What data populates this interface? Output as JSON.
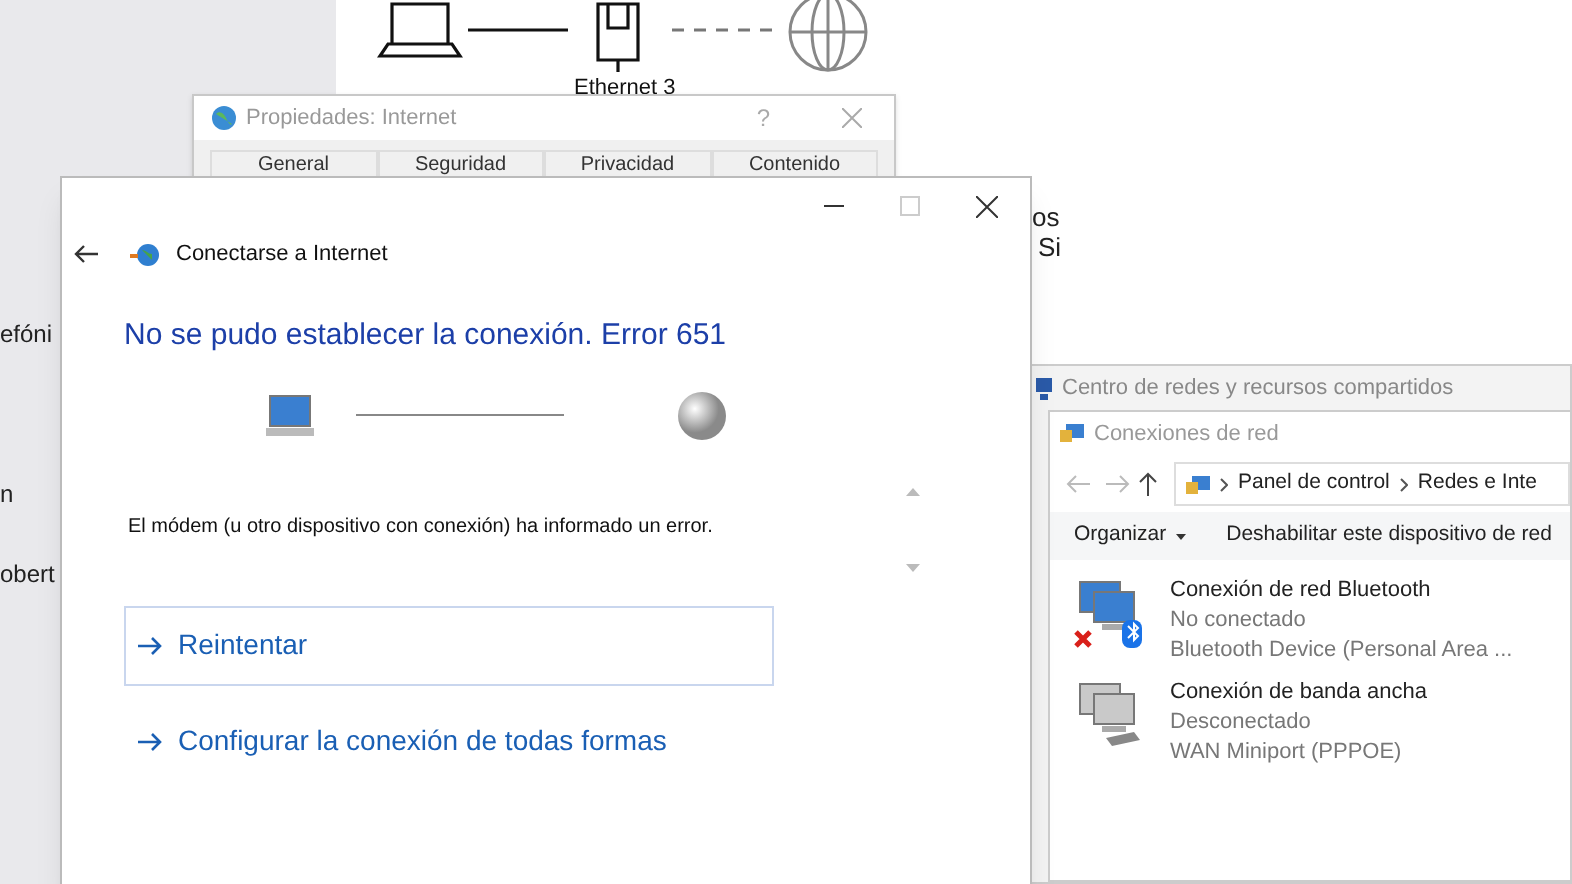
{
  "background": {
    "left_fragments": [
      "efóni",
      "n",
      "obert"
    ],
    "diagram_label": "Ethernet 3",
    "right_fragments": [
      "os",
      "Si"
    ]
  },
  "internet_properties": {
    "title": "Propiedades: Internet",
    "help": "?",
    "tabs": [
      {
        "label": "General"
      },
      {
        "label": "Seguridad"
      },
      {
        "label": "Privacidad"
      },
      {
        "label": "Contenido"
      }
    ]
  },
  "network_center": {
    "title": "Centro de redes y recursos compartidos"
  },
  "network_connections": {
    "title": "Conexiones de red",
    "breadcrumb": [
      "Panel de control",
      "Redes e Inte"
    ],
    "toolbar": [
      {
        "label": "Organizar",
        "dropdown": true
      },
      {
        "label": "Deshabilitar este dispositivo de red",
        "dropdown": false
      }
    ],
    "items": [
      {
        "name": "Conexión de red Bluetooth",
        "status": "No conectado",
        "device": "Bluetooth Device (Personal Area ...",
        "kind": "bluetooth",
        "error": true
      },
      {
        "name": "Conexión de banda ancha",
        "status": "Desconectado",
        "device": "WAN Miniport (PPPOE)",
        "kind": "broadband",
        "error": false
      }
    ]
  },
  "dialog": {
    "title": "Conectarse a Internet",
    "heading": "No se pudo establecer la conexión. Error 651",
    "message": "El módem (u otro dispositivo con conexión) ha informado un error.",
    "options": [
      {
        "label": "Reintentar",
        "selected": true
      },
      {
        "label": "Configurar la conexión de todas formas",
        "selected": false
      }
    ]
  }
}
